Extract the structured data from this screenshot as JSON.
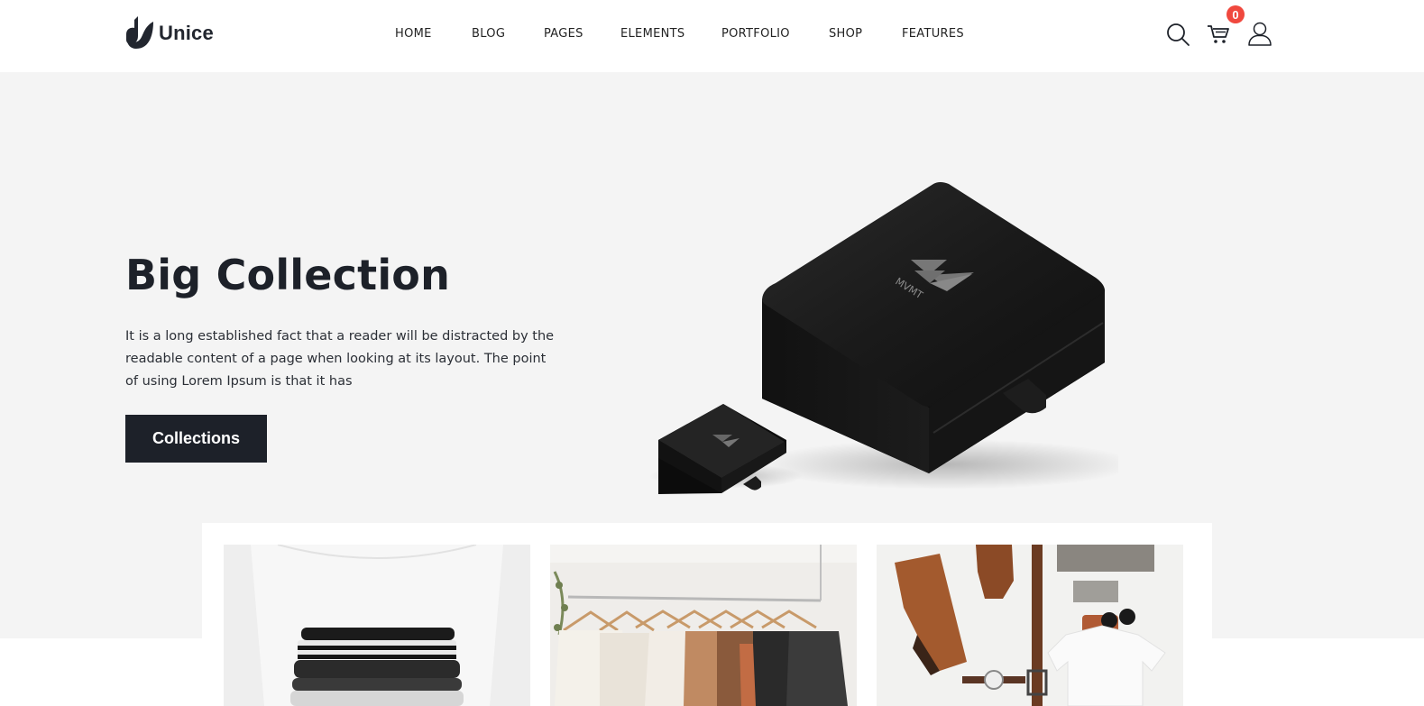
{
  "brand": {
    "name": "Unice"
  },
  "nav": {
    "items": [
      {
        "label": "HOME"
      },
      {
        "label": "BLOG"
      },
      {
        "label": "PAGES"
      },
      {
        "label": "ELEMENTS"
      },
      {
        "label": "PORTFOLIO"
      },
      {
        "label": "SHOP"
      },
      {
        "label": "FEATURES"
      }
    ]
  },
  "header_icons": {
    "search": "search-icon",
    "cart": "cart-icon",
    "user": "user-icon",
    "cart_count": "0",
    "badge_color": "#f0483e"
  },
  "hero": {
    "title": "Big Collection",
    "text": "It is a long established fact that a reader will be distracted by the readable content of a page when looking at its layout. The point of using Lorem Ipsum is that it has",
    "button_label": "Collections",
    "box_brand": "MVMT"
  },
  "colors": {
    "primary": "#1d2129",
    "hero_bg": "#f4f4f4",
    "badge": "#f0483e"
  }
}
